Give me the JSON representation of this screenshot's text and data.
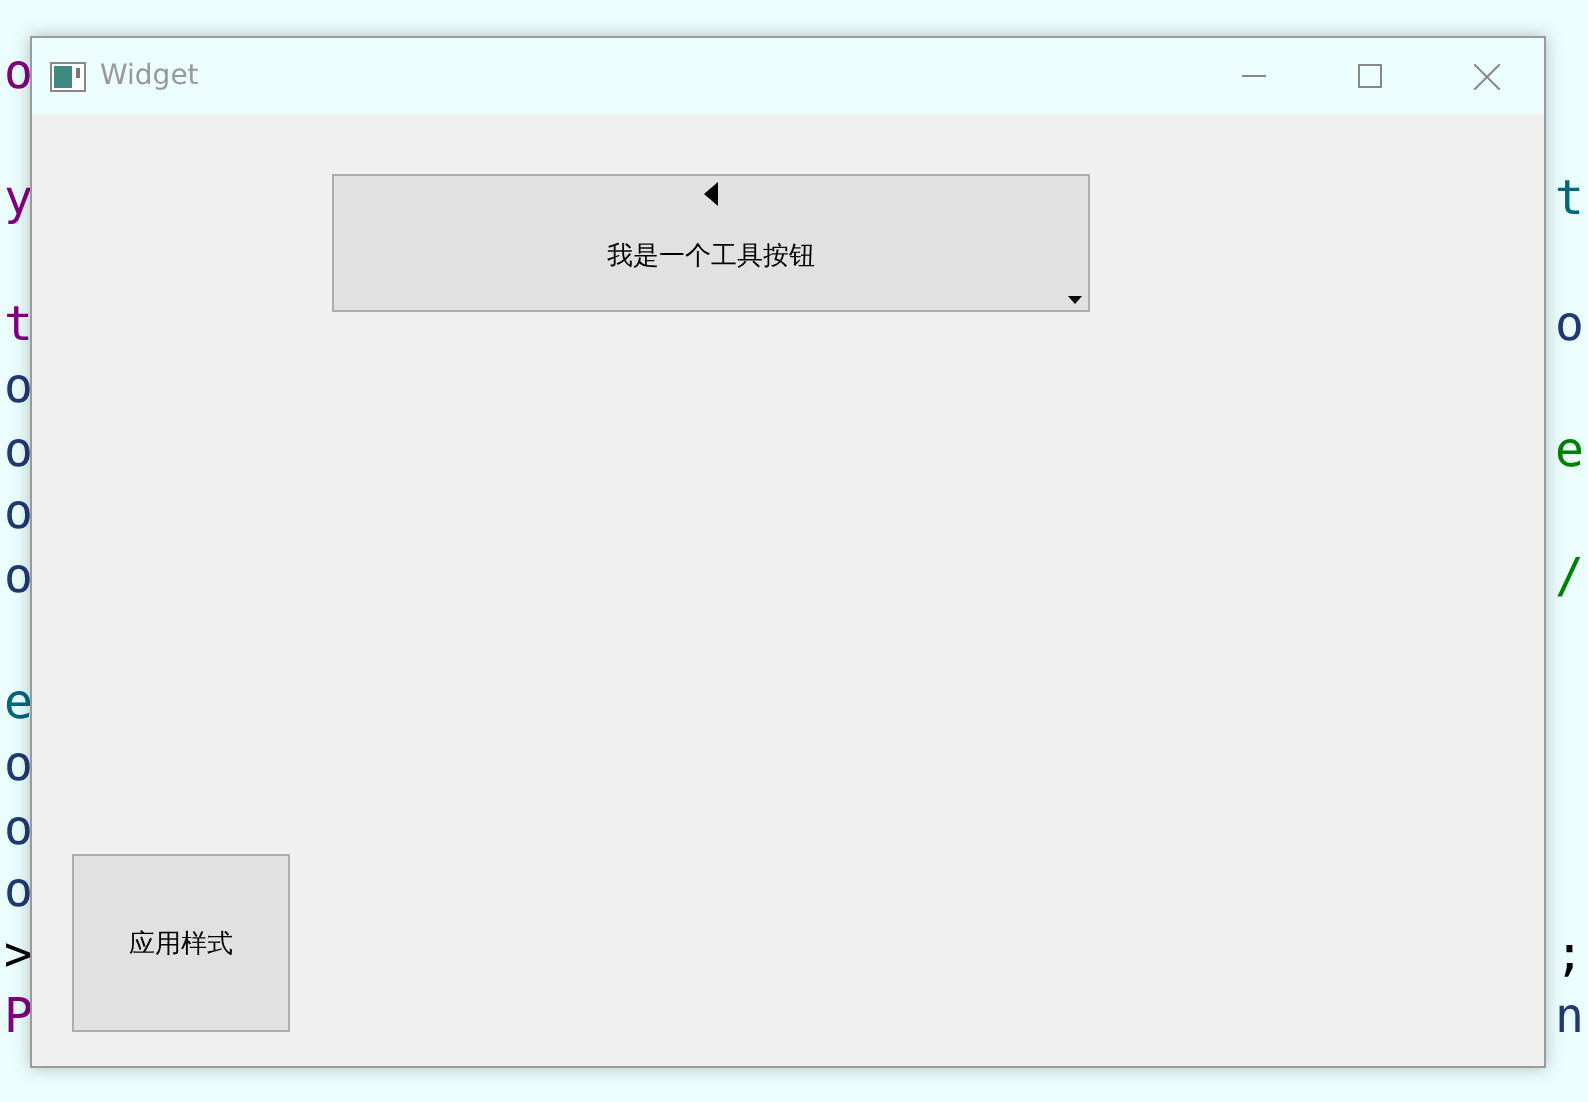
{
  "editor": {
    "blocks": [
      [
        {
          "left": {
            "text": "o",
            "color": "#800080"
          }
        }
      ],
      [
        {
          "left": {
            "text": "y",
            "color": "#800080"
          },
          "right": {
            "text": "t",
            "color": "#00677c"
          }
        }
      ],
      [
        {
          "left": {
            "text": "t",
            "color": "#800080"
          },
          "right": {
            "text": "o",
            "color": "#1f3a73"
          }
        },
        {
          "left": {
            "text": "o",
            "color": "#1f3a73"
          }
        },
        {
          "left": {
            "text": "o",
            "color": "#1f3a73"
          },
          "right": {
            "text": "e",
            "color": "#008000"
          }
        },
        {
          "left": {
            "text": "o",
            "color": "#1f3a73"
          }
        },
        {
          "left": {
            "text": "o",
            "color": "#1f3a73"
          },
          "right": {
            "text": "/",
            "color": "#008000"
          }
        }
      ],
      [
        {
          "left": {
            "text": "e",
            "color": "#00677c"
          }
        },
        {
          "left": {
            "text": "o",
            "color": "#1f3a73"
          }
        },
        {
          "left": {
            "text": "o",
            "color": "#1f3a73"
          }
        },
        {
          "left": {
            "text": "o",
            "color": "#1f3a73"
          }
        },
        {
          "left": {
            "text": ">",
            "color": "#000000"
          },
          "right": {
            "text": ";",
            "color": "#000000"
          }
        },
        {
          "left": {
            "text": "P",
            "color": "#800080"
          },
          "right": {
            "text": "n",
            "color": "#1f3a73"
          }
        }
      ]
    ]
  },
  "window": {
    "title": "Widget"
  },
  "tool_button": {
    "label": "我是一个工具按钮"
  },
  "apply_button": {
    "label": "应用样式"
  }
}
